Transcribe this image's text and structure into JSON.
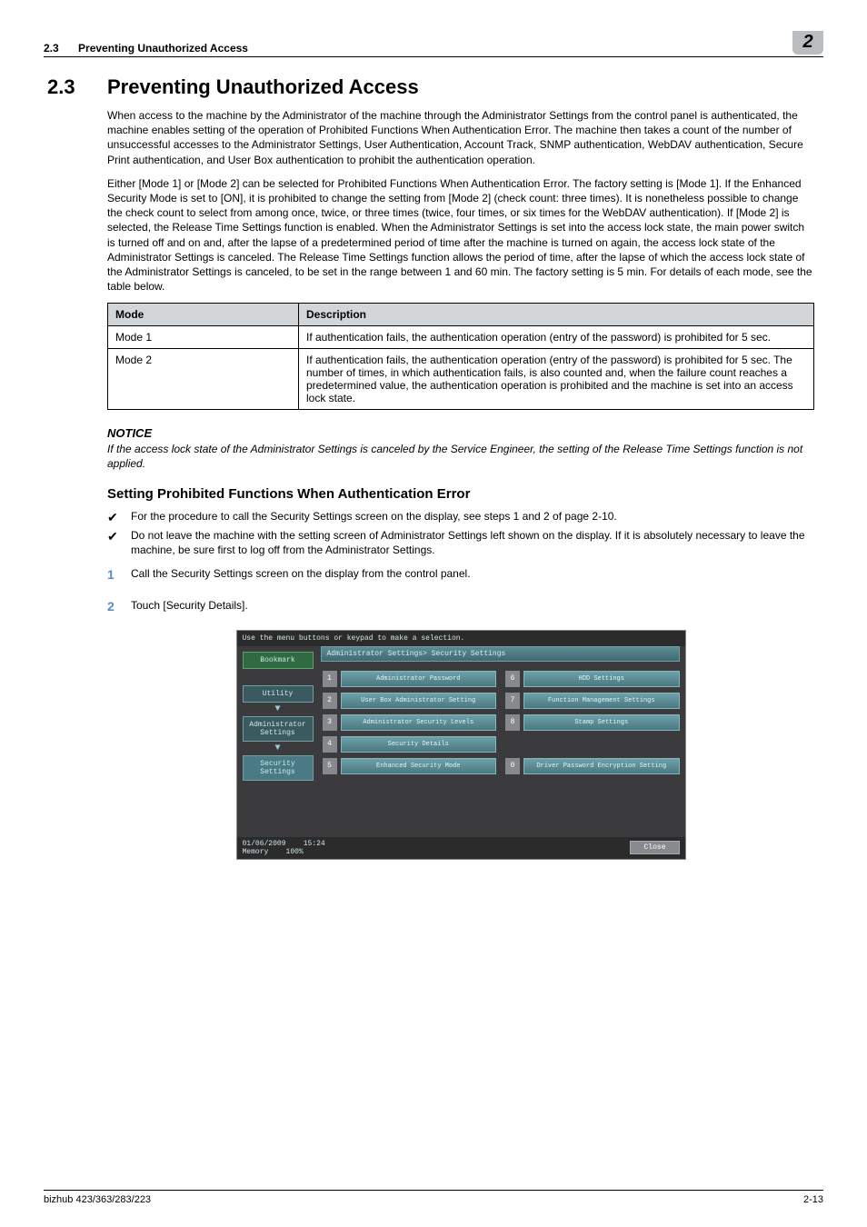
{
  "header": {
    "section_num": "2.3",
    "section_title": "Preventing Unauthorized Access",
    "chapter_num": "2"
  },
  "section": {
    "num": "2.3",
    "name": "Preventing Unauthorized Access",
    "p1": "When access to the machine by the Administrator of the machine through the Administrator Settings from the control panel is authenticated, the machine enables setting of the operation of Prohibited Functions When Authentication Error. The machine then takes a count of the number of unsuccessful accesses to the Administrator Settings, User Authentication, Account Track, SNMP authentication, WebDAV authentication, Secure Print authentication, and User Box authentication to prohibit the authentication operation.",
    "p2": "Either [Mode 1] or [Mode 2] can be selected for Prohibited Functions When Authentication Error. The factory setting is [Mode 1]. If the Enhanced Security Mode is set to [ON], it is prohibited to change the setting from [Mode 2] (check count: three times). It is nonetheless possible to change the check count to select from among once, twice, or three times (twice, four times, or six times for the WebDAV authentication). If [Mode 2] is selected, the Release Time Settings function is enabled. When the Administrator Settings is set into the access lock state, the main power switch is turned off and on and, after the lapse of a predetermined period of time after the machine is turned on again, the access lock state of the Administrator Settings is canceled. The Release Time Settings function allows the period of time, after the lapse of which the access lock state of the Administrator Settings is canceled, to be set in the range between 1 and 60 min. The factory setting is 5 min. For details of each mode, see the table below."
  },
  "table": {
    "h1": "Mode",
    "h2": "Description",
    "rows": [
      {
        "c1": "Mode 1",
        "c2": "If authentication fails, the authentication operation (entry of the password) is prohibited for 5 sec."
      },
      {
        "c1": "Mode 2",
        "c2": "If authentication fails, the authentication operation (entry of the password) is prohibited for 5 sec. The number of times, in which authentication fails, is also counted and, when the failure count reaches a predetermined value, the authentication operation is prohibited and the machine is set into an access lock state."
      }
    ]
  },
  "notice": {
    "label": "NOTICE",
    "text": "If the access lock state of the Administrator Settings is canceled by the Service Engineer, the setting of the Release Time Settings function is not applied."
  },
  "sub": {
    "title": "Setting Prohibited Functions When Authentication Error",
    "b1": "For the procedure to call the Security Settings screen on the display, see steps 1 and 2 of page 2-10.",
    "b2": "Do not leave the machine with the setting screen of Administrator Settings left shown on the display. If it is absolutely necessary to leave the machine, be sure first to log off from the Administrator Settings.",
    "s1n": "1",
    "s1": "Call the Security Settings screen on the display from the control panel.",
    "s2n": "2",
    "s2": "Touch [Security Details]."
  },
  "panel": {
    "top": "Use the menu buttons or keypad to make a selection.",
    "crumb": "Administrator Settings> Security Settings",
    "left": {
      "bookmark": "Bookmark",
      "utility": "Utility",
      "admin": "Administrator Settings",
      "security": "Security Settings"
    },
    "buttons": {
      "n1": "1",
      "l1": "Administrator Password",
      "n2": "2",
      "l2": "User Box Administrator Setting",
      "n3": "3",
      "l3": "Administrator Security Levels",
      "n4": "4",
      "l4": "Security Details",
      "n5": "5",
      "l5": "Enhanced Security Mode",
      "n6": "6",
      "l6": "HDD Settings",
      "n7": "7",
      "l7": "Function Management Settings",
      "n8": "8",
      "l8": "Stamp Settings",
      "n0": "0",
      "l0": "Driver Password Encryption Setting"
    },
    "foot": {
      "date": "01/06/2009",
      "time": "15:24",
      "mem": "Memory",
      "memv": "100%",
      "close": "Close"
    }
  },
  "footer": {
    "left": "bizhub 423/363/283/223",
    "right": "2-13"
  }
}
